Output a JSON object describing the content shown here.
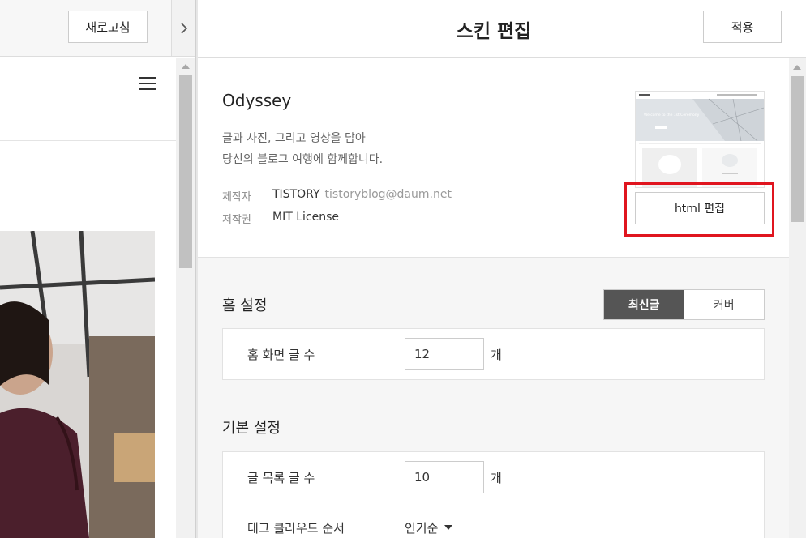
{
  "left": {
    "refresh_label": "새로고침"
  },
  "header": {
    "title": "스킨 편집",
    "apply_label": "적용"
  },
  "skin": {
    "name": "Odyssey",
    "description_line1": "글과 사진, 그리고 영상을 담아",
    "description_line2": "당신의 블로그 여행에 함께합니다.",
    "author_label": "제작자",
    "author_name": "TISTORY",
    "author_email": "tistoryblog@daum.net",
    "license_label": "저작권",
    "license_value": "MIT License",
    "html_edit_label": "html 편집",
    "thumb_text": "Welcome to the 1st Ceremony"
  },
  "home_settings": {
    "title": "홈 설정",
    "tabs": [
      {
        "label": "최신글",
        "active": true
      },
      {
        "label": "커버",
        "active": false
      }
    ],
    "rows": [
      {
        "label": "홈 화면 글 수",
        "value": "12",
        "unit": "개"
      }
    ]
  },
  "basic_settings": {
    "title": "기본 설정",
    "post_count_label": "글 목록 글 수",
    "post_count_value": "10",
    "post_count_unit": "개",
    "tag_order_label": "태그 클라우드 순서",
    "tag_order_value": "인기순"
  },
  "colors": {
    "highlight": "#e0151f",
    "active_tab": "#555555"
  }
}
